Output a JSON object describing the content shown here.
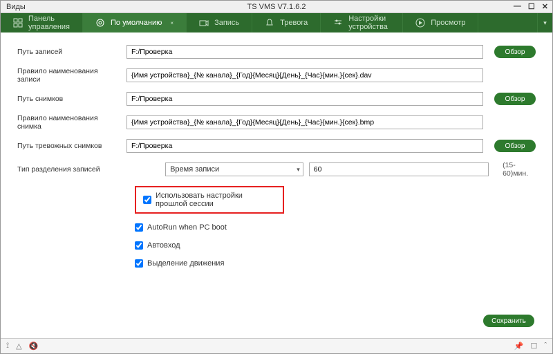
{
  "titlebar": {
    "views": "Виды",
    "title": "TS VMS V7.1.6.2"
  },
  "nav": {
    "control_panel": "Панель управления",
    "default": "По умолчанию",
    "record": "Запись",
    "alarm": "Тревога",
    "device_settings": "Настройки устройства",
    "preview": "Просмотр"
  },
  "fields": {
    "record_path_label": "Путь записей",
    "record_path_value": "F:/Проверка",
    "record_rule_label": "Правило наименования записи",
    "record_rule_value": "{Имя устройства}_{№ канала}_{Год}{Месяц}{День}_{Час}{мин.}{сек}.dav",
    "snapshot_path_label": "Путь снимков",
    "snapshot_path_value": "F:/Проверка",
    "snapshot_rule_label": "Правило наименования снимка",
    "snapshot_rule_value": "{Имя устройства}_{№ канала}_{Год}{Месяц}{День}_{Час}{мин.}{сек}.bmp",
    "alarm_snapshot_path_label": "Путь тревожных снимков",
    "alarm_snapshot_path_value": "F:/Проверка",
    "split_type_label": "Тип разделения записей",
    "split_type_selected": "Время записи",
    "split_value": "60",
    "split_hint": "(15-60)мин."
  },
  "buttons": {
    "browse": "Обзор",
    "save": "Сохранить"
  },
  "checks": {
    "use_prev_session": "Использовать настройки прошлой сессии",
    "autorun": "AutoRun when PC boot",
    "autologin": "Автовход",
    "motion": "Выделение движения"
  }
}
